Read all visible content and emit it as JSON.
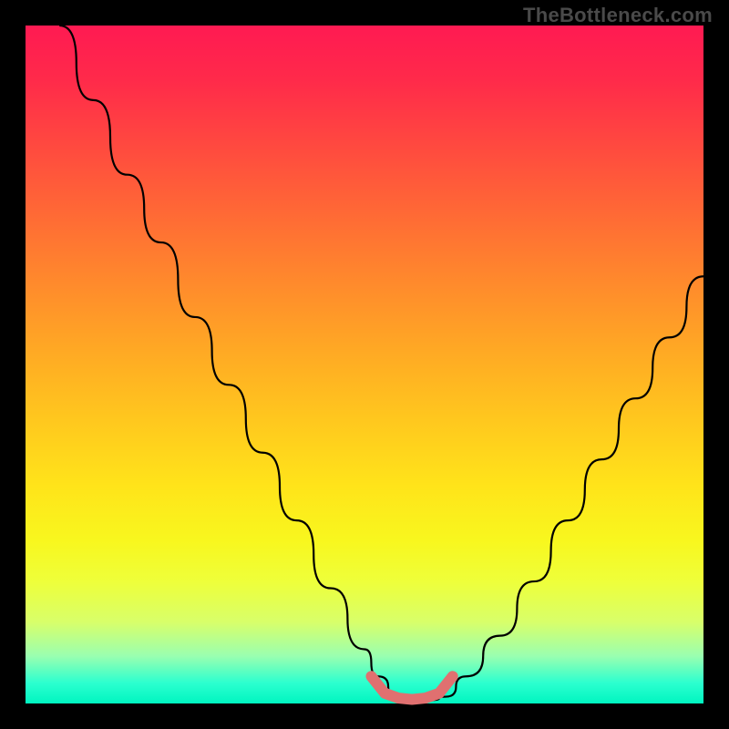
{
  "watermark": "TheBottleneck.com",
  "chart_data": {
    "type": "line",
    "title": "",
    "xlabel": "",
    "ylabel": "",
    "xlim": [
      0,
      100
    ],
    "ylim": [
      0,
      100
    ],
    "series": [
      {
        "name": "bottleneck-curve",
        "color": "#000000",
        "x": [
          5,
          10,
          15,
          20,
          25,
          30,
          35,
          40,
          45,
          50,
          52,
          55,
          58,
          60,
          62,
          65,
          70,
          75,
          80,
          85,
          90,
          95,
          100
        ],
        "y": [
          100,
          89,
          78,
          68,
          57,
          47,
          37,
          27,
          17,
          8,
          4,
          1,
          0.5,
          0.5,
          1,
          4,
          10,
          18,
          27,
          36,
          45,
          54,
          63
        ]
      },
      {
        "name": "optimal-zone-marker",
        "color": "#e07070",
        "x": [
          51,
          53,
          55,
          57,
          59,
          61,
          63
        ],
        "y": [
          4,
          1.5,
          0.8,
          0.6,
          0.8,
          1.5,
          4
        ]
      }
    ],
    "annotations": []
  }
}
